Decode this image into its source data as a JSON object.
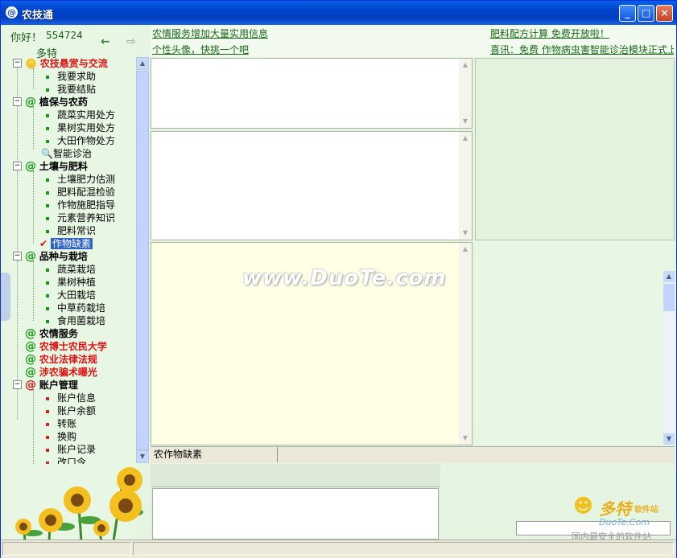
{
  "window": {
    "title": "农技通",
    "app_icon": "@",
    "minimize": "_",
    "maximize": "□",
    "close": "×"
  },
  "user": {
    "greeting": "你好！",
    "id": "554724",
    "nickname": "多特"
  },
  "nav": {
    "back_icon": "←",
    "forward_icon": "⇨"
  },
  "links": {
    "news1": "农情服务增加大量实用信息",
    "news2": "个性头像，快挑一个吧",
    "right1": "肥料配方计算 免费开放啦！",
    "right2": "喜讯：免费 作物病虫害智能诊治模块正式上"
  },
  "tree": {
    "groups": [
      {
        "label": "农技悬赏与交流",
        "style": "red",
        "icon": "coins-icon",
        "items": [
          "我要求助",
          "我要结贴"
        ]
      },
      {
        "label": "植保与农药",
        "style": "bold",
        "icon": "at-icon",
        "items": [
          "蔬菜实用处方",
          "果树实用处方",
          "大田作物处方"
        ],
        "extra": "智能诊治"
      },
      {
        "label": "土壤与肥料",
        "style": "bold",
        "icon": "at-icon",
        "items": [
          "土壤肥力估测",
          "肥料配混检验",
          "作物施肥指导",
          "元素营养知识",
          "肥料常识"
        ],
        "selected": "作物缺素"
      },
      {
        "label": "品种与栽培",
        "style": "bold",
        "icon": "at-icon",
        "items": [
          "蔬菜栽培",
          "果树种植",
          "大田栽培",
          "中草药栽培",
          "食用菌栽培"
        ]
      },
      {
        "label": "农情服务",
        "style": "bold",
        "icon": "at-icon"
      },
      {
        "label": "农博士农民大学",
        "style": "red",
        "icon": "at-icon"
      },
      {
        "label": "农业法律法规",
        "style": "red",
        "icon": "at-icon"
      },
      {
        "label": "涉农骗术曝光",
        "style": "red",
        "icon": "at-icon"
      },
      {
        "label": "账户管理",
        "style": "bold",
        "icon": "at-red-icon",
        "items": [
          "账户信息",
          "账户余额",
          "转账",
          "换购",
          "账户记录",
          "改口令"
        ]
      }
    ]
  },
  "tab": {
    "label": "农作物缺素"
  },
  "watermark": "www.DuoTe.com",
  "logo": {
    "main": "多特",
    "sub": "软件站",
    "url": "DuoTe.Com",
    "slogan": "国内最安全的软件站"
  },
  "colors": {
    "accent": "#0043c8",
    "red": "#e01010",
    "green": "#1aa01a"
  }
}
